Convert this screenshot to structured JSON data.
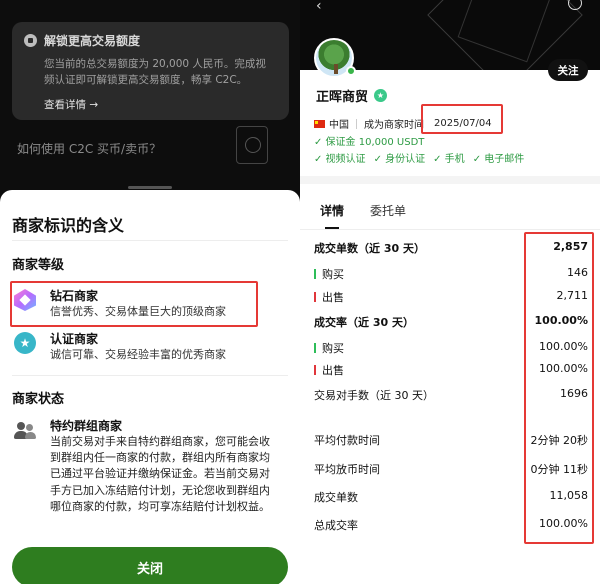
{
  "left": {
    "banner": {
      "title": "解锁更高交易额度",
      "desc_line1": "您当前的总交易额度为 20,000 人民币。完成视",
      "desc_line2": "频认证即可解锁更高交易额度，畅享 C2C。",
      "more": "查看详情 →"
    },
    "bg_question": "如何使用 C2C 买币/卖币？",
    "sheet": {
      "title": "商家标识的含义",
      "level_heading": "商家等级",
      "diamond": {
        "title": "钻石商家",
        "desc": "信誉优秀、交易体量巨大的顶级商家"
      },
      "certified": {
        "title": "认证商家",
        "desc": "诚信可靠、交易经验丰富的优秀商家"
      },
      "status_heading": "商家状态",
      "group": {
        "title": "特约群组商家",
        "lines": [
          "当前交易对手来自特约群组商家，您可能会收",
          "到群组内任一商家的付款，群组内所有商家均",
          "已通过平台验证并缴纳保证金。若当前交易对",
          "手方已加入冻结赔付计划，无论您收到群组内",
          "哪位商家的付款，均可享冻结赔付计划权益。"
        ]
      },
      "close_label": "关闭"
    }
  },
  "right": {
    "follow_label": "关注",
    "merchant_name": "正晖商贸",
    "country": "中国",
    "since_label": "成为商家时间",
    "since_date": "2025/07/04",
    "deposit": "✓ 保证金 10,000 USDT",
    "badges": [
      "✓ 视频认证",
      "✓ 身份认证",
      "✓ 手机",
      "✓ 电子邮件"
    ],
    "tabs": [
      "详情",
      "委托单"
    ],
    "stats": {
      "orders30": {
        "label": "成交单数（近 30 天）",
        "value": "2,857"
      },
      "buy": {
        "label": "购买",
        "value": "146"
      },
      "sell": {
        "label": "出售",
        "value": "2,711"
      },
      "rate30": {
        "label": "成交率（近 30 天）",
        "value": "100.00%"
      },
      "buy_rate": {
        "label": "购买",
        "value": "100.00%"
      },
      "sell_rate": {
        "label": "出售",
        "value": "100.00%"
      },
      "counterparties": {
        "label": "交易对手数（近 30 天）",
        "value": "1696"
      },
      "avg_pay": {
        "label": "平均付款时间",
        "value": "2分钟 20秒"
      },
      "avg_release": {
        "label": "平均放币时间",
        "value": "0分钟 11秒"
      },
      "total_orders": {
        "label": "成交单数",
        "value": "11,058"
      },
      "total_rate": {
        "label": "总成交率",
        "value": "100.00%"
      }
    }
  },
  "colors": {
    "accent_green": "#2e7d1f",
    "highlight_red": "#e53935",
    "buy_green": "#2ebd59",
    "sell_red": "#e0363b"
  }
}
